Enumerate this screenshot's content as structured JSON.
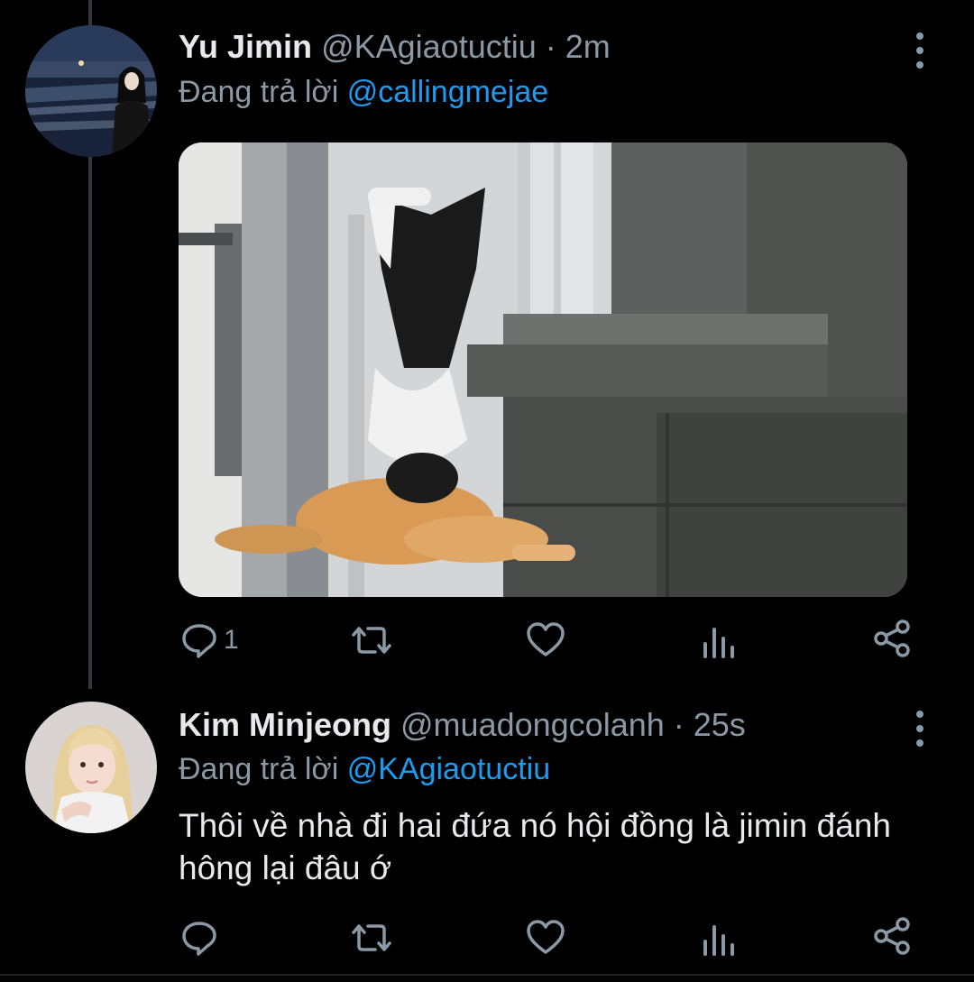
{
  "colors": {
    "background": "#000000",
    "text": "#e7e9ea",
    "secondary": "#8b98a5",
    "link": "#1d9bf0"
  },
  "tweets": [
    {
      "name": "Yu Jimin",
      "handle": "@KAgiaotuctiu",
      "separator": " · ",
      "time": "2m",
      "reply_prefix": "Đang trả lời ",
      "reply_to": "@callingmejae",
      "text": "",
      "reply_count": "1",
      "avatar_icon": "avatar-photo-night-sea",
      "media_icon": "cat-photo"
    },
    {
      "name": "Kim Minjeong",
      "handle": "@muadongcolanh",
      "separator": " · ",
      "time": "25s",
      "reply_prefix": "Đang trả lời ",
      "reply_to": "@KAgiaotuctiu",
      "text": "Thôi về nhà đi hai đứa nó hội đồng là jimin đánh hông lại đâu ớ",
      "reply_count": "",
      "avatar_icon": "avatar-photo-blonde",
      "media_icon": ""
    }
  ],
  "action_icons": [
    "reply-icon",
    "retweet-icon",
    "like-icon",
    "analytics-icon",
    "share-icon"
  ]
}
